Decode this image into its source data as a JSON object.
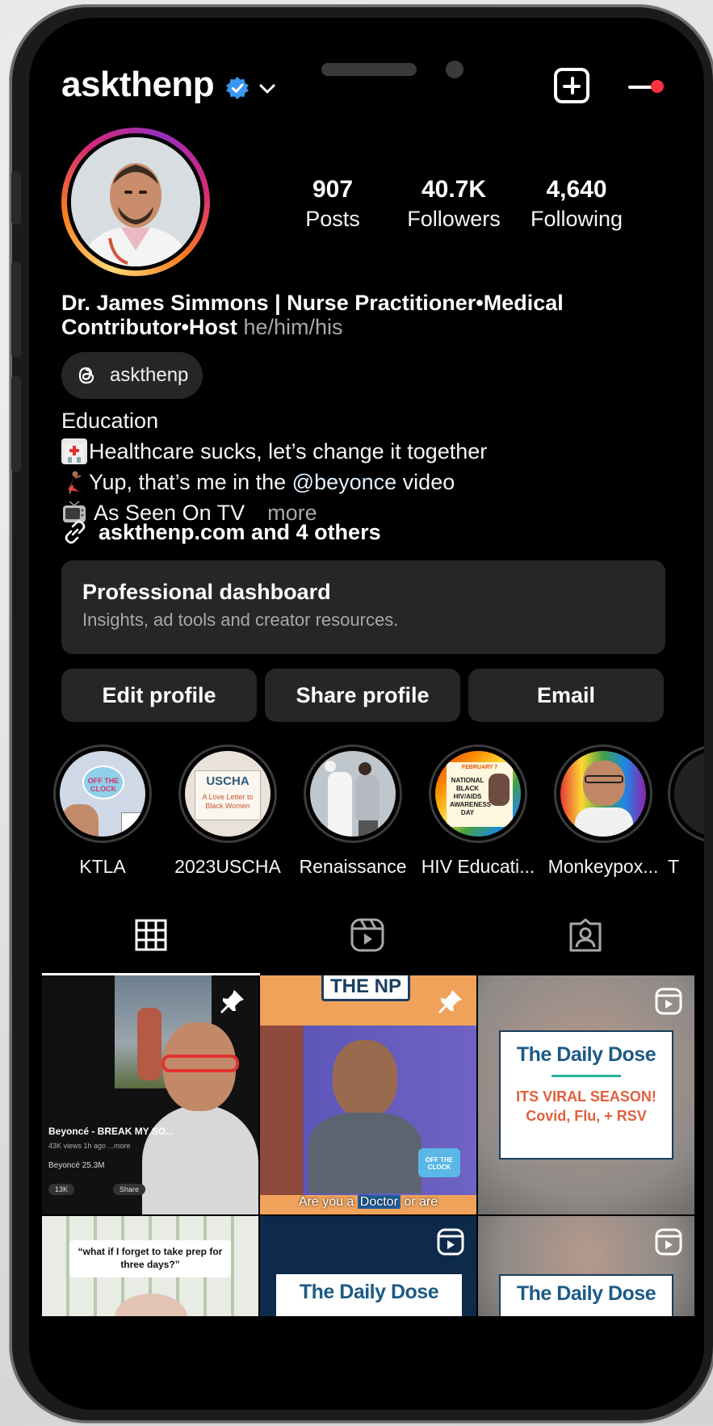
{
  "header": {
    "username": "askthenp",
    "verified_icon": "verified-badge-icon",
    "dropdown_icon": "chevron-down-icon",
    "create_icon": "plus-square-icon",
    "menu_icon": "hamburger-menu-icon",
    "notification_dot_color": "#ff3040"
  },
  "stats": [
    {
      "value": "907",
      "label": "Posts"
    },
    {
      "value": "40.7K",
      "label": "Followers"
    },
    {
      "value": "4,640",
      "label": "Following"
    }
  ],
  "bio": {
    "name": "Dr. James Simmons | Nurse Practitioner•Medical Contributor•Host",
    "pronouns": "he/him/his",
    "threads_handle": "askthenp",
    "category": "Education",
    "line1": "Healthcare sucks, let’s change it together",
    "line2_pre": "Yup, that’s me in the ",
    "line2_mention": "@beyonce",
    "line2_post": " video",
    "line3": "As Seen On TV",
    "more": "more",
    "link": "askthenp.com and 4 others"
  },
  "dashboard": {
    "title": "Professional dashboard",
    "subtitle": "Insights, ad tools and creator resources."
  },
  "actions": {
    "edit": "Edit profile",
    "share": "Share profile",
    "email": "Email"
  },
  "highlights": [
    {
      "label": "KTLA"
    },
    {
      "label": "2023USCHA"
    },
    {
      "label": "Renaissance"
    },
    {
      "label": "HIV Educati..."
    },
    {
      "label": "Monkeypox..."
    },
    {
      "label": "T"
    }
  ],
  "highlight_art": {
    "ktla_clock": "OFF THE CLOCK",
    "uscha_title": "USCHA",
    "uscha_sub": "A Love Letter to Black Women",
    "hiv_top": "FEBRUARY 7",
    "hiv_main": "NATIONAL BLACK HIV/AIDS AWARENESS DAY"
  },
  "tabs": {
    "grid_icon": "grid-icon",
    "reels_icon": "reels-icon",
    "tagged_icon": "tagged-person-icon"
  },
  "posts": {
    "p1_caption": "Beyoncé - BREAK MY SO...",
    "p1_meta": "43K views  1h ago  ...more",
    "p1_channel": "Beyoncé  25.3M",
    "p1_likes": "13K",
    "p1_share": "Share",
    "p2_banner": "THE NP",
    "p2_subtitle_pre": "Are you a ",
    "p2_subtitle_hl": "Doctor",
    "p2_subtitle_post": " or are",
    "p2_clock": "OFF THE CLOCK",
    "dd_title": "The Daily Dose",
    "dd_sub": "ITS VIRAL SEASON! Covid, Flu, + RSV",
    "p4_quote": "“what if I forget to take prep for three days?”",
    "pin_icon": "pin-icon",
    "reel_icon": "reel-badge-icon"
  }
}
